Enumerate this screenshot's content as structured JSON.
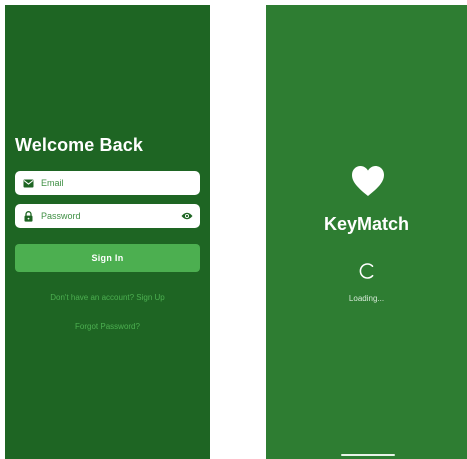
{
  "login": {
    "title": "Welcome Back",
    "email_placeholder": "Email",
    "password_placeholder": "Password",
    "sign_in_label": "Sign In",
    "signup_link": "Don't have an account? Sign Up",
    "forgot_link": "Forgot Password?",
    "icons": {
      "email": "email-icon",
      "lock": "lock-icon",
      "visibility": "eye-icon"
    }
  },
  "splash": {
    "app_name": "KeyMatch",
    "loading_text": "Loading...",
    "icons": {
      "logo": "heart-icon",
      "spinner": "spinner-icon"
    }
  },
  "colors": {
    "login_bg": "#1e6523",
    "splash_bg": "#2e7d32",
    "accent": "#4caf50",
    "text_on_dark": "#ffffff"
  }
}
